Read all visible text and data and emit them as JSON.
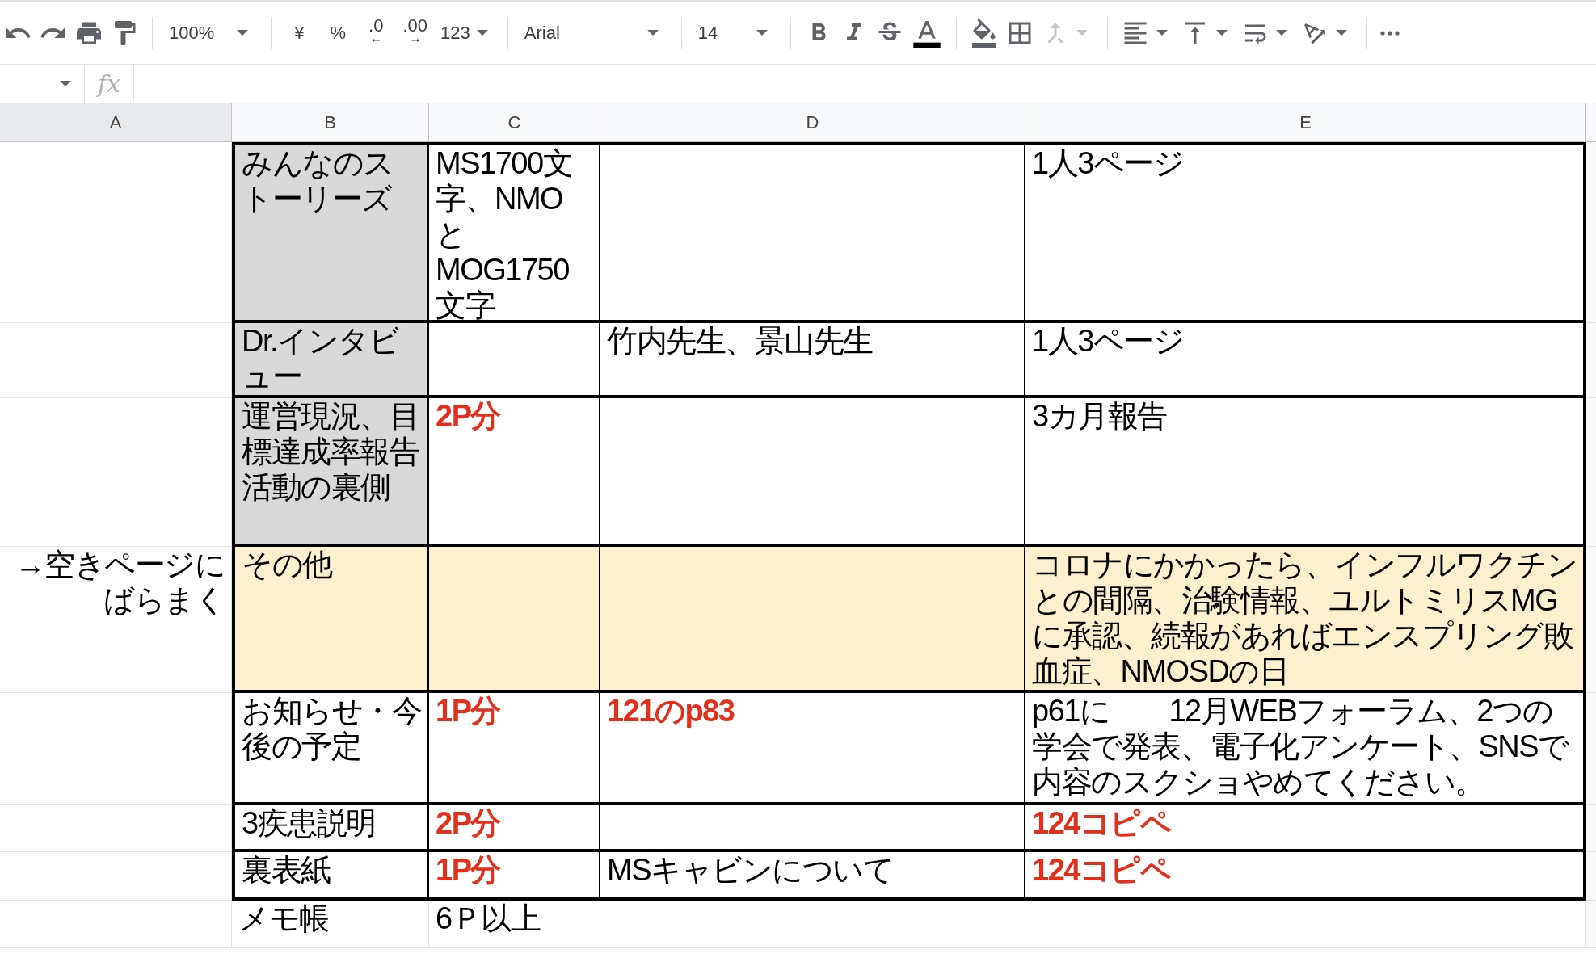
{
  "toolbar": {
    "zoom": "100%",
    "currency": "¥",
    "percent": "%",
    "decrease_decimals": ".0",
    "increase_decimals": ".00",
    "number_format": "123",
    "font": "Arial",
    "font_size": "14",
    "merge_disabled": true
  },
  "formula_bar": {
    "fx": "fx"
  },
  "columns": [
    {
      "label": "A",
      "selected": true
    },
    {
      "label": "B",
      "selected": false
    },
    {
      "label": "C",
      "selected": false
    },
    {
      "label": "D",
      "selected": false
    },
    {
      "label": "E",
      "selected": false
    }
  ],
  "rows": [
    {
      "bordered": true,
      "cells": [
        null,
        {
          "text": "みんなのストーリーズ",
          "color": "#d9d9d9"
        },
        {
          "text": "MS1700文字、NMOとMOG1750文字"
        },
        null,
        {
          "text": "1人3ページ"
        }
      ]
    },
    {
      "bordered": true,
      "cells": [
        null,
        {
          "text": "Dr.インタビュー",
          "color": "#d9d9d9"
        },
        null,
        {
          "text": "竹内先生、景山先生"
        },
        {
          "text": "1人3ページ"
        }
      ]
    },
    {
      "bordered": true,
      "cells": [
        null,
        {
          "text": "運営現況、目標達成率報告活動の裏側",
          "color": "#d9d9d9"
        },
        {
          "text": "2P分",
          "emphasis": true
        },
        null,
        {
          "text": "3カ月報告"
        }
      ]
    },
    {
      "bordered": true,
      "cells": [
        {
          "text": "→空きページにばらまく",
          "right_aligned": true
        },
        {
          "text": "その他",
          "color": "#fcf0cf"
        },
        {
          "color": "#fcf0cf"
        },
        {
          "color": "#fcf0cf"
        },
        {
          "text": "コロナにかかったら、インフルワクチンとの間隔、治験情報、ユルトミリスMGに承認、続報があればエンスプリング敗血症、NMOSDの日",
          "color": "#fcf0cf"
        }
      ]
    },
    {
      "bordered": true,
      "cells": [
        null,
        {
          "text": "お知らせ・今後の予定"
        },
        {
          "text": "1P分",
          "emphasis": true
        },
        {
          "text": "121のp83",
          "emphasis": true
        },
        {
          "text": "p61に　　12月WEBフォーラム、2つの学会で発表、電子化アンケート、SNSで内容のスクショやめてください。"
        }
      ]
    },
    {
      "bordered": true,
      "cells": [
        null,
        {
          "text": "3疾患説明"
        },
        {
          "text": "2P分",
          "emphasis": true
        },
        null,
        {
          "text": "124コピペ",
          "emphasis": true
        }
      ]
    },
    {
      "bordered": true,
      "cells": [
        null,
        {
          "text": "裏表紙"
        },
        {
          "text": "1P分",
          "emphasis": true
        },
        {
          "text": "MSキャビンについて"
        },
        {
          "text": "124コピペ",
          "emphasis": true
        }
      ]
    },
    {
      "bordered": false,
      "cells": [
        null,
        {
          "text": "メモ帳"
        },
        {
          "text": "6Ｐ以上"
        },
        null,
        null
      ]
    }
  ]
}
